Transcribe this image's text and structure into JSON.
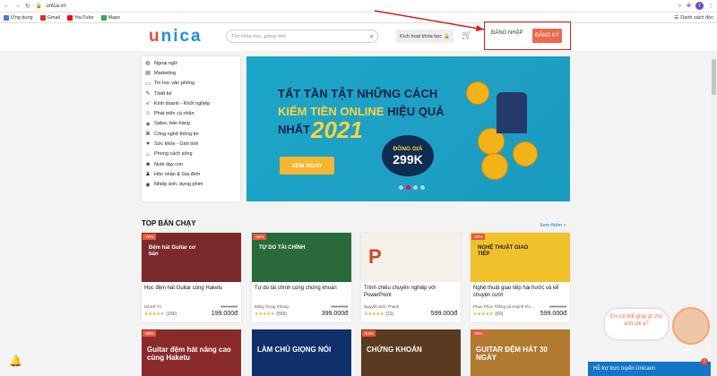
{
  "browser": {
    "url": "unica.vn",
    "bookmarks": [
      "Ứng dụng",
      "Gmail",
      "YouTube",
      "Maps"
    ],
    "reading_list": "Danh sách đọc",
    "profile": "T"
  },
  "header": {
    "logo": "unica",
    "search_placeholder": "Tìm khóa học, giảng viên",
    "activate": "Kích hoạt khóa học",
    "login": "ĐĂNG NHẬP",
    "register": "ĐĂNG KÝ"
  },
  "sidebar": {
    "items": [
      {
        "label": "Ngoại ngữ",
        "icon": "language-icon"
      },
      {
        "label": "Marketing",
        "icon": "chart-icon"
      },
      {
        "label": "Tin học văn phòng",
        "icon": "monitor-icon"
      },
      {
        "label": "Thiết kế",
        "icon": "pen-icon"
      },
      {
        "label": "Kinh doanh - Khởi nghiệp",
        "icon": "rocket-icon"
      },
      {
        "label": "Phát triển cá nhân",
        "icon": "person-icon"
      },
      {
        "label": "Sales, bán hàng",
        "icon": "tag-icon"
      },
      {
        "label": "Công nghệ thông tin",
        "icon": "code-icon"
      },
      {
        "label": "Sức khỏe - Giới tính",
        "icon": "heart-icon"
      },
      {
        "label": "Phong cách sống",
        "icon": "shirt-icon"
      },
      {
        "label": "Nuôi dạy con",
        "icon": "baby-icon"
      },
      {
        "label": "Hôn nhân & Gia đình",
        "icon": "family-icon"
      },
      {
        "label": "Nhiếp ảnh, dựng phim",
        "icon": "camera-icon"
      }
    ]
  },
  "banner": {
    "line1": "TẤT TẦN TẬT NHỮNG CÁCH",
    "line2_highlight": "KIẾM TIỀN ONLINE",
    "line2_rest": "HIỆU QUẢ",
    "line3": "NHẤT",
    "year": "2021",
    "cta": "XEM NGAY",
    "price_label": "ĐỒNG GIÁ",
    "price": "299K"
  },
  "section": {
    "title": "TOP BÁN CHẠY",
    "see_more": "Xem thêm »"
  },
  "courses": [
    {
      "discount": "-72%",
      "thumb_text": "Đệm hát Guitar cơ bản",
      "title": "Học đệm hát Guitar cùng Haketu",
      "author": "Hà Kế Tú",
      "old_price": "700.000đ",
      "price": "199.000đ",
      "rating": "★★★★★",
      "reviews": "(156)",
      "bg": "#7a2a2a"
    },
    {
      "discount": "-34%",
      "thumb_text": "TỰ DO TÀI CHÍNH",
      "title": "Tự do tài chính cùng chứng khoán",
      "author": "Đặng Trọng Khang",
      "old_price": "600.000đ",
      "price": "399.000đ",
      "rating": "★★★★★",
      "reviews": "(565)",
      "bg": "#2a6a3a"
    },
    {
      "discount": "",
      "thumb_text": "P",
      "title": "Trình chiếu chuyên nghiệp với PowerPoint",
      "author": "Nguyễn Đức Thanh",
      "old_price": "",
      "price": "599.000đ",
      "rating": "★★★★★",
      "reviews": "(21)",
      "bg": "#f4f0ea"
    },
    {
      "discount": "-34%",
      "thumb_text": "NGHỆ THUẬT GIAO TIẾP",
      "title": "Nghệ thuật giao tiếp hài hước và kể chuyện cười",
      "author": "Phan Phúc Thắng và Huỳnh Thị ...",
      "old_price": "900.000đ",
      "price": "599.000đ",
      "rating": "★★★★★",
      "reviews": "(60)",
      "bg": "#f0c12a"
    }
  ],
  "courses_row2": [
    {
      "discount": "-63%",
      "text": "Guitar đệm hát nâng cao cùng Haketu",
      "bg": "#8a2b2b"
    },
    {
      "discount": "",
      "text": "LÀM CHỦ GIỌNG NÓI",
      "bg": "#10306b"
    },
    {
      "discount": "-51%",
      "text": "CHỨNG KHOÁN",
      "bg": "#5a3a20"
    },
    {
      "discount": "-34%",
      "text": "GUITAR ĐỆM HÁT 30 NGÀY",
      "bg": "#b07a30"
    }
  ],
  "chat": {
    "bubble": "Em có thể giúp gì cho anh chị ạ?",
    "bar": "Hỗ trợ trực tuyến Unicavn",
    "badge": "1"
  },
  "colors": {
    "brand_blue": "#1d8fe1",
    "brand_red": "#e94c37",
    "register_bg": "#ea6b50",
    "highlight_box": "#d81e1e"
  }
}
